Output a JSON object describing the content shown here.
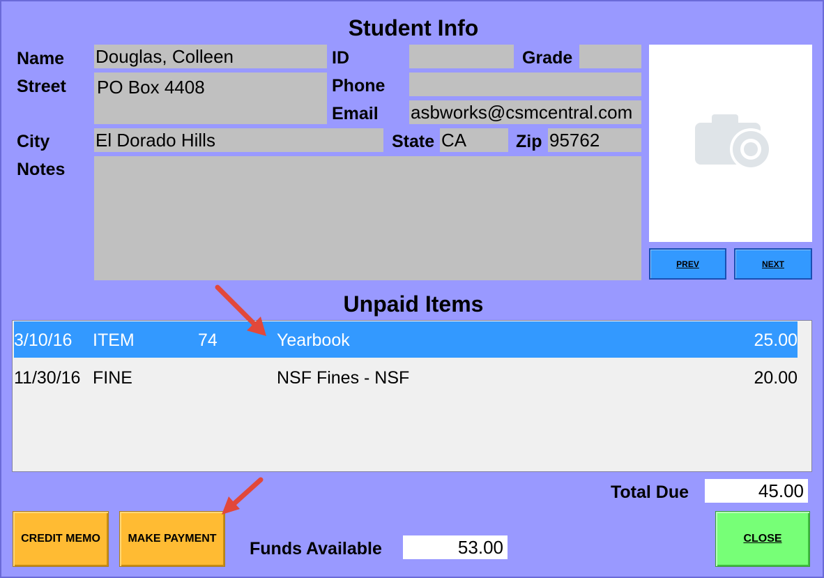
{
  "student_info": {
    "title": "Student Info",
    "labels": {
      "name": "Name",
      "street": "Street",
      "city": "City",
      "notes": "Notes",
      "id": "ID",
      "grade": "Grade",
      "phone": "Phone",
      "email": "Email",
      "state": "State",
      "zip": "Zip"
    },
    "values": {
      "name": "Douglas, Colleen",
      "street": "PO Box 4408",
      "city": "El Dorado Hills",
      "id": "",
      "grade": "",
      "phone": "",
      "email": "asbworks@csmcentral.com",
      "state": "CA",
      "zip": "95762",
      "notes": ""
    },
    "photo_icon": "camera-icon",
    "prev_label": "PREV",
    "next_label": "NEXT"
  },
  "unpaid_items": {
    "title": "Unpaid Items",
    "rows": [
      {
        "date": "3/10/16",
        "type": "ITEM",
        "code": "74",
        "description": "Yearbook",
        "amount": "25.00",
        "selected": true
      },
      {
        "date": "11/30/16",
        "type": "FINE",
        "code": "",
        "description": "NSF Fines - NSF",
        "amount": "20.00",
        "selected": false
      }
    ],
    "total_due_label": "Total Due",
    "total_due": "45.00"
  },
  "footer": {
    "credit_memo_label": "CREDIT MEMO",
    "make_payment_label": "MAKE PAYMENT",
    "funds_available_label": "Funds Available",
    "funds_available": "53.00",
    "close_label": "CLOSE"
  },
  "colors": {
    "background": "#9999ff",
    "field": "#c0c0c0",
    "selected_row": "#3399ff",
    "orange_button": "#ffbb33",
    "green_button": "#77ff77",
    "annotation_arrow": "#e2483a"
  }
}
